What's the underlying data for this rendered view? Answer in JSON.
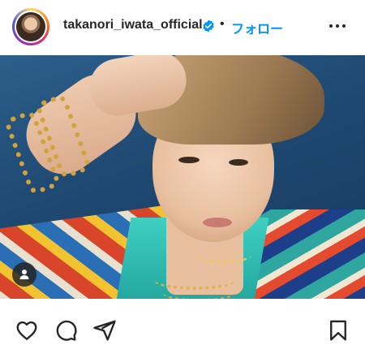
{
  "post_header": {
    "username": "takanori_iwata_official",
    "verified_icon": "verified-badge-icon",
    "separator": "•",
    "follow_label": "フォロー",
    "more_icon": "more-options-icon"
  },
  "photo": {
    "tag_icon": "user-tag-icon"
  },
  "actions": {
    "like_icon": "heart-icon",
    "comment_icon": "comment-icon",
    "share_icon": "share-icon",
    "save_icon": "bookmark-icon"
  },
  "colors": {
    "follow_blue": "#0095f6",
    "verified_blue": "#0095f6",
    "text": "#262626"
  }
}
